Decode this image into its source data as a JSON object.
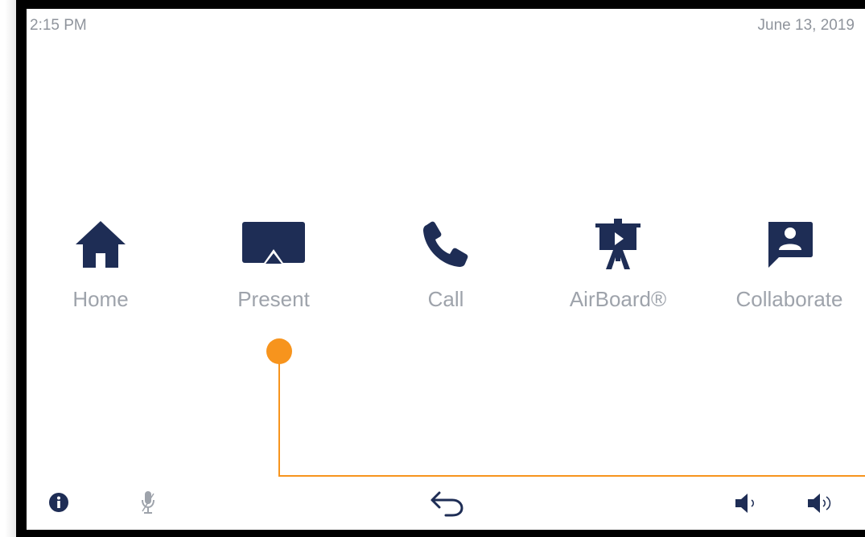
{
  "status_bar": {
    "time": "2:15 PM",
    "date": "June 13, 2019"
  },
  "tiles": [
    {
      "label": "Home",
      "icon": "house-icon"
    },
    {
      "label": "Present",
      "icon": "airplay-display-icon"
    },
    {
      "label": "Call",
      "icon": "phone-icon"
    },
    {
      "label": "AirBoard®",
      "icon": "easel-board-icon"
    },
    {
      "label": "Collaborate",
      "icon": "contact-chat-icon"
    }
  ],
  "bottom_bar": {
    "left": [
      "info-icon",
      "microphone-muted-icon"
    ],
    "center": [
      "back-arrow-icon"
    ],
    "right": [
      "volume-down-icon",
      "volume-up-icon"
    ]
  },
  "colors": {
    "icon": "#1e2d55",
    "label": "#9ea3ab",
    "status": "#8f949c",
    "callout": "#f7941d",
    "bezel": "#000000"
  }
}
